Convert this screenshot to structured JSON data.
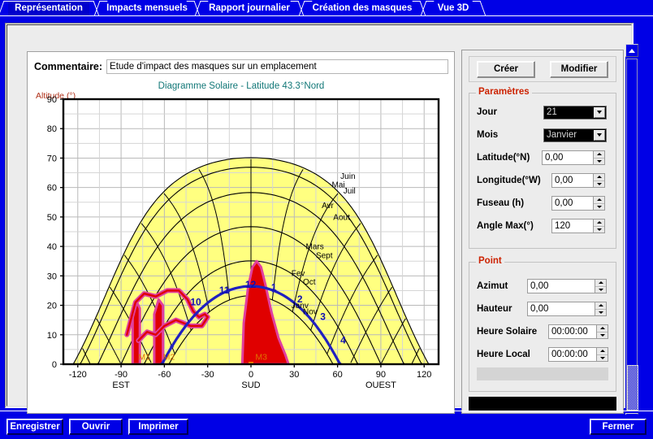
{
  "tabs": [
    {
      "label": "Représentation",
      "selected": true
    },
    {
      "label": "Impacts mensuels",
      "selected": false
    },
    {
      "label": "Rapport journalier",
      "selected": false
    },
    {
      "label": "Création des masques",
      "selected": false
    },
    {
      "label": "Vue 3D",
      "selected": false
    }
  ],
  "comment": {
    "label": "Commentaire:",
    "value": "Etude d'impact des masques sur un emplacement"
  },
  "panel": {
    "create_button": "Créer",
    "modify_button": "Modifier",
    "parameters_group": "Paramètres",
    "point_group": "Point",
    "fields": [
      {
        "label": "Jour",
        "value": "21",
        "type": "combo"
      },
      {
        "label": "Mois",
        "value": "Janvier",
        "type": "combo"
      },
      {
        "label": "Latitude(°N)",
        "value": "0,00",
        "type": "spin"
      },
      {
        "label": "Longitude(°W)",
        "value": "0,00",
        "type": "spin"
      },
      {
        "label": "Fuseau (h)",
        "value": "0,00",
        "type": "spin"
      },
      {
        "label": "Angle Max(°)",
        "value": "120",
        "type": "spin"
      }
    ],
    "point_fields": [
      {
        "label": "Azimut",
        "value": "0,00"
      },
      {
        "label": "Hauteur",
        "value": "0,00"
      },
      {
        "label": "Heure Solaire",
        "value": "00:00:00"
      },
      {
        "label": "Heure Local",
        "value": "00:00:00"
      }
    ]
  },
  "footer": {
    "save": "Enregistrer",
    "open": "Ouvrir",
    "print": "Imprimer",
    "close": "Fermer"
  },
  "colors": {
    "window_blue": "#0000e6",
    "sky_yellow": "#ffff80",
    "mask_red": "#e00000",
    "mask_magenta": "#e040a0",
    "sunpath_blue": "#2020c0",
    "title_teal": "#117777",
    "axis_label_red": "#b03018",
    "group_title_red": "#cc2200",
    "hour_label_blue": "#1010b0",
    "mask_label_orange": "#e07000"
  },
  "chart_data": {
    "type": "line",
    "title": "Diagramme Solaire - Latitude 43.3°Nord",
    "ylabel": "Altitude (°)",
    "xlabel": "",
    "xlim": [
      -130,
      130
    ],
    "ylim": [
      0,
      90
    ],
    "xticks": [
      -120,
      -90,
      -60,
      -30,
      0,
      30,
      60,
      90,
      120
    ],
    "yticks": [
      0,
      10,
      20,
      30,
      40,
      50,
      60,
      70,
      80,
      90
    ],
    "xtick_sublabels": [
      {
        "at": -90,
        "text": "EST"
      },
      {
        "at": 0,
        "text": "SUD"
      },
      {
        "at": 90,
        "text": "OUEST"
      }
    ],
    "grid": true,
    "legend": "none",
    "month_curves": [
      {
        "name": "Juin",
        "declination": 23.4,
        "label_x": 62,
        "label_y": 63
      },
      {
        "name": "Mai",
        "declination": 20.0,
        "label_x": 56,
        "label_y": 60
      },
      {
        "name": "Juil",
        "declination": 20.0,
        "label_x": 64,
        "label_y": 58
      },
      {
        "name": "Avr",
        "declination": 11.5,
        "label_x": 49,
        "label_y": 53
      },
      {
        "name": "Aout",
        "declination": 11.5,
        "label_x": 57,
        "label_y": 49
      },
      {
        "name": "Mars",
        "declination": 0.0,
        "label_x": 38,
        "label_y": 39
      },
      {
        "name": "Sept",
        "declination": 0.0,
        "label_x": 45,
        "label_y": 36
      },
      {
        "name": "Fev",
        "declination": -11.5,
        "label_x": 28,
        "label_y": 30
      },
      {
        "name": "Oct",
        "declination": -11.5,
        "label_x": 36,
        "label_y": 27
      },
      {
        "name": "Janv",
        "declination": -20.0,
        "label_x": 28,
        "label_y": 19
      },
      {
        "name": "Nov",
        "declination": -20.0,
        "label_x": 36,
        "label_y": 17
      }
    ],
    "hour_labels": [
      {
        "text": "10",
        "x": -42,
        "y": 20
      },
      {
        "text": "11",
        "x": -22,
        "y": 24
      },
      {
        "text": "12",
        "x": -4,
        "y": 26
      },
      {
        "text": "1",
        "x": 14,
        "y": 25
      },
      {
        "text": "2",
        "x": 32,
        "y": 21
      },
      {
        "text": "3",
        "x": 48,
        "y": 15
      },
      {
        "text": "4",
        "x": 62,
        "y": 7
      }
    ],
    "masks": [
      {
        "name": "M1",
        "label_x": -78,
        "label_y": 1.5
      },
      {
        "name": "M2",
        "label_x": -61,
        "label_y": 1.5
      },
      {
        "name": "M3",
        "label_x": 3,
        "label_y": 1.5
      }
    ],
    "sun_path_day": "21 Janvier"
  }
}
